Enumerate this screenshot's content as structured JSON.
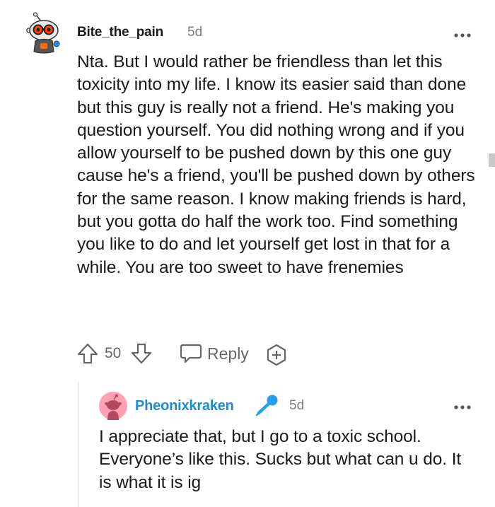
{
  "comment": {
    "username": "Bite_the_pain",
    "time": "5d",
    "body": "Nta. But I would rather be friendless than let this toxicity into my life. I know its easier said than done but this guy is really not a friend. He's making you question yourself. You did nothing wrong and if you allow yourself to be pushed down by this one guy cause he's a friend, you'll be pushed down by others for the same reason. I know making friends is hard, but you gotta do half the work too. Find something you like to do and let yourself get lost in that for a while. You are too sweet to have frenemies",
    "score": "50",
    "reply_label": "Reply"
  },
  "reply": {
    "username": "Pheonixkraken",
    "time": "5d",
    "body": "I appreciate that, but I go to a toxic school. Everyone’s like this. Sucks but what can u do. It is what it is ig"
  },
  "icons": {
    "avatar_1": "robot-snoo-avatar",
    "avatar_2": "default-snoo-avatar",
    "more": "more-options-icon",
    "upvote": "upvote-arrow-icon",
    "downvote": "downvote-arrow-icon",
    "reply": "speech-bubble-icon",
    "award": "award-plus-icon",
    "voice": "microphone-icon"
  },
  "colors": {
    "reply_username": "#1f8bd0",
    "mic": "#24a0ed",
    "avatar2_bg": "#ff9fb2",
    "meta_grey": "#7c7c7c"
  }
}
